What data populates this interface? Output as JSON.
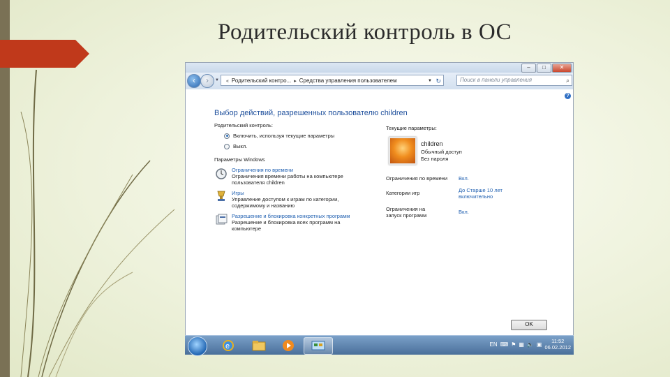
{
  "slide": {
    "title": "Родительский контроль в ОС"
  },
  "window": {
    "breadcrumb": [
      "Родительский контро...",
      "Средства управления пользователем"
    ],
    "search_placeholder": "Поиск в панели управления",
    "heading": "Выбор действий, разрешенных пользователю children",
    "parental_control_label": "Родительский контроль:",
    "radio_on": "Включить, используя текущие параметры",
    "radio_off": "Выкл.",
    "windows_settings_label": "Параметры Windows",
    "options": [
      {
        "link": "Ограничения по времени",
        "desc": "Ограничения времени работы на компьютере пользователя children",
        "icon": "clock-icon"
      },
      {
        "link": "Игры",
        "desc": "Управление доступом к играм по категории, содержимому и названию",
        "icon": "games-icon"
      },
      {
        "link": "Разрешение и блокировка конкретных программ",
        "desc": "Разрешение и блокировка всех программ на компьютере",
        "icon": "programs-icon"
      }
    ],
    "current_settings_label": "Текущие параметры:",
    "user": {
      "name": "children",
      "role": "Обычный доступ",
      "password": "Без пароля"
    },
    "settings": [
      {
        "label": "Ограничения по времени",
        "value": "Вкл."
      },
      {
        "label": "Категории игр",
        "value": "До Старше 10 лет включительно"
      },
      {
        "label": "Ограничения на запуск программ",
        "value": "Вкл."
      }
    ],
    "ok_label": "OK"
  },
  "taskbar": {
    "lang": "EN",
    "time": "11:52",
    "date": "06.02.2012"
  },
  "colors": {
    "accent": "#1f5fb0",
    "slide_red": "#c0391b",
    "slide_olive": "#7a7155"
  }
}
